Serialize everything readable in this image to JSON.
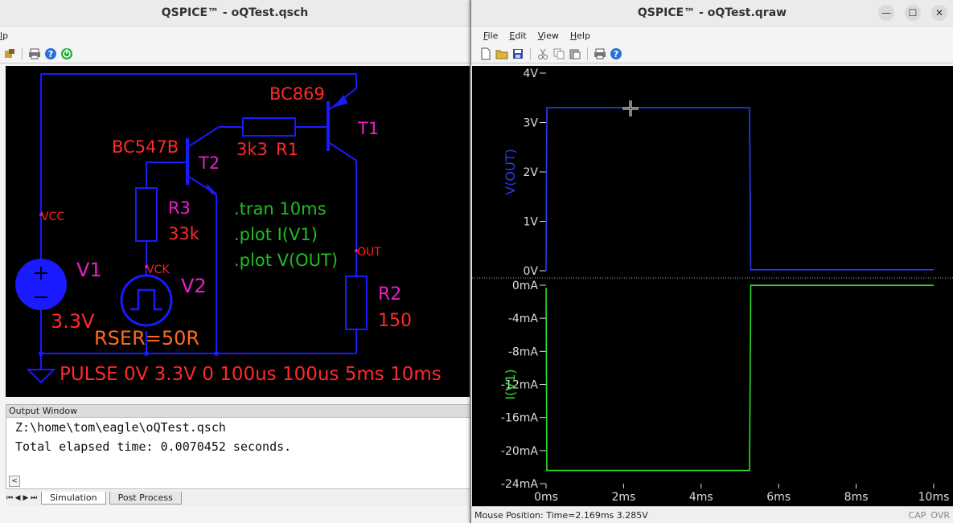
{
  "schematic_window": {
    "title": "QSPICE™ - oQTest.qsch",
    "menu_visible_fragment": "lp",
    "schematic": {
      "components": [
        {
          "ref": "T1",
          "model": "BC869"
        },
        {
          "ref": "T2",
          "model": "BC547B"
        },
        {
          "ref": "R1",
          "value": "3k3"
        },
        {
          "ref": "R2",
          "value": "150"
        },
        {
          "ref": "R3",
          "value": "33k"
        },
        {
          "ref": "V1",
          "value": "3.3V"
        },
        {
          "ref": "V2",
          "rser": "RSER=50R",
          "pulse": "PULSE 0V 3.3V 0 100us 100us 5ms 10ms"
        }
      ],
      "nets": [
        "VCC",
        "VCK",
        "OUT"
      ],
      "directives": [
        ".tran 10ms",
        ".plot I(V1)",
        ".plot V(OUT)"
      ]
    },
    "output_window": {
      "title": "Output Window",
      "lines": [
        "Z:\\home\\tom\\eagle\\oQTest.qsch",
        "Total elapsed time: 0.0070452 seconds."
      ]
    },
    "tabs": [
      {
        "label": "Simulation",
        "active": true
      },
      {
        "label": "Post Process",
        "active": false
      }
    ]
  },
  "waveform_window": {
    "title": "QSPICE™ - oQTest.qraw",
    "menu": [
      "File",
      "Edit",
      "View",
      "Help"
    ],
    "status": {
      "mouse_position": "Mouse Position: Time=2.169ms  3.285V",
      "cap": "CAP",
      "ovr": "OVR"
    }
  },
  "chart_data": [
    {
      "type": "line",
      "ylabel": "V(OUT)",
      "ylim": [
        0,
        4
      ],
      "yticks": [
        "0V",
        "1V",
        "2V",
        "3V",
        "4V"
      ],
      "xlim": [
        0,
        10
      ],
      "x_unit": "ms",
      "series": [
        {
          "name": "V(OUT)",
          "color": "#2a3cf0",
          "x": [
            0,
            0.02,
            5.25,
            5.28,
            10
          ],
          "y": [
            0,
            3.3,
            3.3,
            0.02,
            0.02
          ]
        }
      ]
    },
    {
      "type": "line",
      "ylabel": "I(V1)",
      "ylim": [
        -24,
        0
      ],
      "yticks": [
        "0mA",
        "-4mA",
        "-8mA",
        "-12mA",
        "-16mA",
        "-20mA",
        "-24mA"
      ],
      "xlim": [
        0,
        10
      ],
      "xticks": [
        "0ms",
        "2ms",
        "4ms",
        "6ms",
        "8ms",
        "10ms"
      ],
      "series": [
        {
          "name": "I(V1)",
          "color": "#2ee02e",
          "x": [
            0,
            0.02,
            5.25,
            5.28,
            10
          ],
          "y": [
            -0.3,
            -22.4,
            -22.4,
            -0.02,
            -0.02
          ]
        }
      ]
    }
  ]
}
